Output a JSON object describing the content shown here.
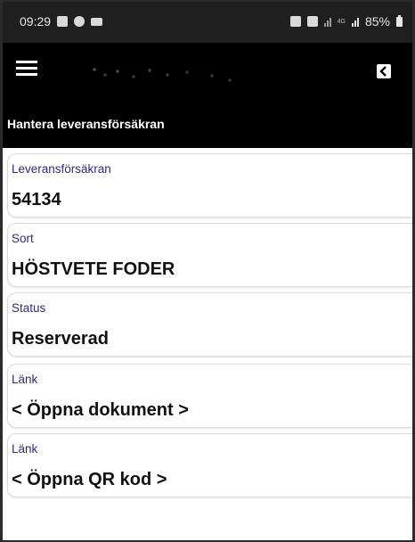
{
  "status_bar": {
    "time": "09:29",
    "battery": "85%",
    "network": "4G",
    "left_icons": [
      "gallery-icon",
      "messenger-icon",
      "sync-icon"
    ],
    "right_icons": [
      "vpn-icon",
      "alarm-icon",
      "signal-icon",
      "signal-icon",
      "battery-icon"
    ]
  },
  "app_bar": {
    "menu_icon": "hamburger-menu-icon",
    "back_icon": "back-arrow-icon"
  },
  "page": {
    "title": "Hantera leveransförsäkran"
  },
  "fields": [
    {
      "label": "Leveransförsäkran",
      "value": "54134"
    },
    {
      "label": "Sort",
      "value": "HÖSTVETE FODER"
    },
    {
      "label": "Status",
      "value": "Reserverad"
    },
    {
      "label": "Länk",
      "value": "< Öppna dokument >"
    },
    {
      "label": "Länk",
      "value": "< Öppna QR kod >"
    }
  ],
  "colors": {
    "label": "#2e2b84",
    "header_bg": "#000000",
    "status_bar_bg": "#1f1f1f"
  }
}
